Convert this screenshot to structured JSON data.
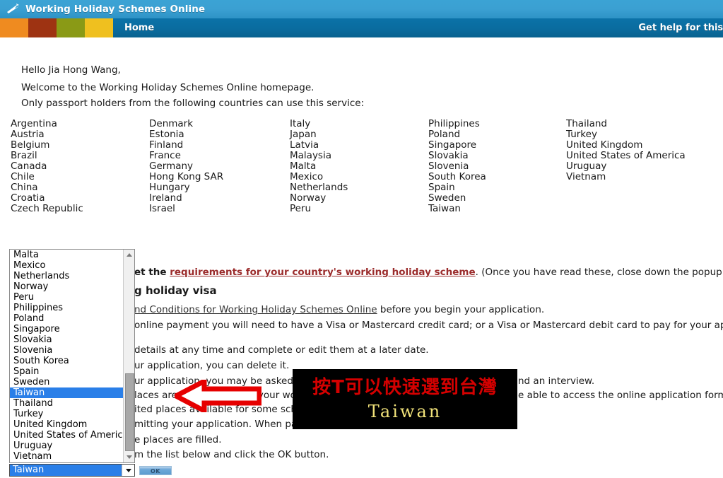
{
  "window": {
    "title": "Working Holiday Schemes Online",
    "logo_icon": "swoosh-flag-icon"
  },
  "nav": {
    "home_label": "Home",
    "help_label": "Get help for this p",
    "swatch_colors": [
      "#ef8b20",
      "#9e3312",
      "#8a9a16",
      "#efc01f"
    ]
  },
  "greeting": {
    "hello": "Hello Jia Hong Wang,",
    "welcome": "Welcome to the Working Holiday Schemes Online homepage.",
    "eligibility": "Only passport holders from the following countries can use this service:"
  },
  "country_columns": [
    [
      "Argentina",
      "Austria",
      "Belgium",
      "Brazil",
      "Canada",
      "Chile",
      "China",
      "Croatia",
      "Czech Republic"
    ],
    [
      "Denmark",
      "Estonia",
      "Finland",
      "France",
      "Germany",
      "Hong Kong SAR",
      "Hungary",
      "Ireland",
      "Israel"
    ],
    [
      "Italy",
      "Japan",
      "Latvia",
      "Malaysia",
      "Malta",
      "Mexico",
      "Netherlands",
      "Norway",
      "Peru"
    ],
    [
      "Philippines",
      "Poland",
      "Singapore",
      "Slovakia",
      "Slovenia",
      "South Korea",
      "Spain",
      "Sweden",
      "Taiwan"
    ],
    [
      "Thailand",
      "Turkey",
      "United Kingdom",
      "United States of America",
      "Uruguay",
      "Vietnam"
    ]
  ],
  "paragraphs": {
    "p1_pre": "et the ",
    "p1_link": "requirements for your country's working holiday scheme",
    "p1_post": ". (Once you have read these, close down the popup window and retu",
    "heading": "g holiday visa",
    "p2_link": "nd Conditions for Working Holiday Schemes Online",
    "p2_post": " before you begin your application.",
    "p3": "online payment you will need to have a Visa or Mastercard credit card; or a Visa or Mastercard debit card to pay for your application. If you do",
    "p4": " details at any time and complete or edit them at a later date.",
    "p5": "ur application, you can delete it.",
    "p6_a": "ur application, you may be asked to pr",
    "p6_b": "nd an interview.",
    "p7_a": "laces are \"available unde",
    "p7_b": " your wor",
    "p7_c": "e able to access the online application form.",
    "p8": "ited places available for some scheme",
    "p9": "mitting your application. When payme",
    "p10": "e places are filled.",
    "p11": "m the list below and click the OK button."
  },
  "dropdown": {
    "name": "country-select",
    "selected": "Taiwan",
    "items": [
      "Malta",
      "Mexico",
      "Netherlands",
      "Norway",
      "Peru",
      "Philippines",
      "Poland",
      "Singapore",
      "Slovakia",
      "Slovenia",
      "South Korea",
      "Spain",
      "Sweden",
      "Taiwan",
      "Thailand",
      "Turkey",
      "United Kingdom",
      "United States of America",
      "Uruguay",
      "Vietnam"
    ],
    "highlight_color": "#2a7fe8"
  },
  "ok_button": {
    "label": "OK"
  },
  "annotation": {
    "arrow": "left-pointing-red-arrow",
    "caption_cn": "按T可以快速選到台灣",
    "caption_en": "Taiwan",
    "caption_cn_color": "#d40000",
    "caption_en_color": "#f2e37a",
    "caption_bg": "#000000"
  }
}
